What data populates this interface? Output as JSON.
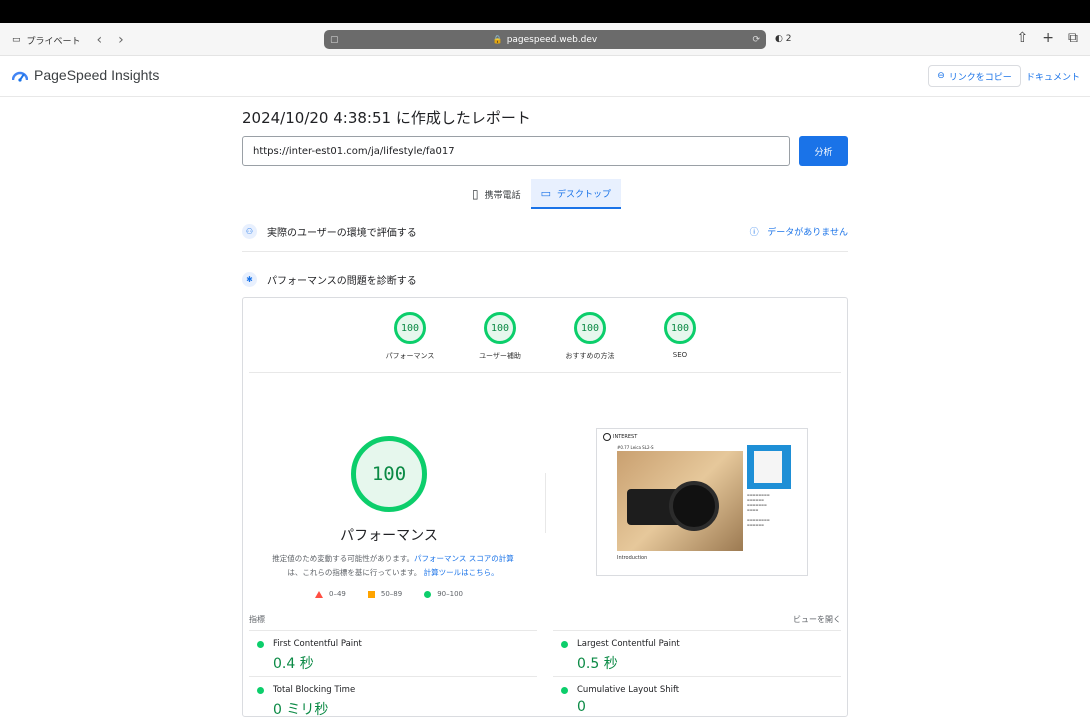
{
  "browser": {
    "private_label": "プライベート",
    "url": "pagespeed.web.dev",
    "tracker_count": "2"
  },
  "header": {
    "app_title": "PageSpeed Insights",
    "copy_link": "リンクをコピー",
    "docs": "ドキュメント"
  },
  "report": {
    "title": "2024/10/20 4:38:51 に作成したレポート",
    "url_value": "https://inter-est01.com/ja/lifestyle/fa017",
    "analyze": "分析"
  },
  "device_tabs": {
    "mobile": "携帯電話",
    "desktop": "デスクトップ"
  },
  "sections": {
    "field": "実際のユーザーの環境で評価する",
    "no_data": "データがありません",
    "diagnose": "パフォーマンスの問題を診断する"
  },
  "scores": [
    {
      "value": "100",
      "label": "パフォーマンス"
    },
    {
      "value": "100",
      "label": "ユーザー補助"
    },
    {
      "value": "100",
      "label": "おすすめの方法"
    },
    {
      "value": "100",
      "label": "SEO"
    }
  ],
  "main_score": {
    "value": "100",
    "label": "パフォーマンス",
    "note_1": "推定値のため変動する可能性があります。",
    "note_link_1": "パフォーマンス スコアの計算",
    "note_2": "は、これらの指標を基に行っています。",
    "note_link_2": "計算ツールはこちら。"
  },
  "legend": {
    "fail": "0–49",
    "average": "50–89",
    "pass": "90–100"
  },
  "metrics": {
    "heading": "指標",
    "view_toggle": "ビューを開く",
    "items": [
      {
        "name": "First Contentful Paint",
        "value": "0.4 秒"
      },
      {
        "name": "Largest Contentful Paint",
        "value": "0.5 秒"
      },
      {
        "name": "Total Blocking Time",
        "value": "0 ミリ秒"
      },
      {
        "name": "Cumulative Layout Shift",
        "value": "0"
      }
    ]
  },
  "screenshot": {
    "site_name": "INTEREST",
    "page_title": "#0.77 Leica SL2-S",
    "intro": "Introduction"
  },
  "colors": {
    "pass": "#0cce6b",
    "average": "#ffa400",
    "fail": "#ff4e42",
    "accent": "#1a73e8"
  }
}
